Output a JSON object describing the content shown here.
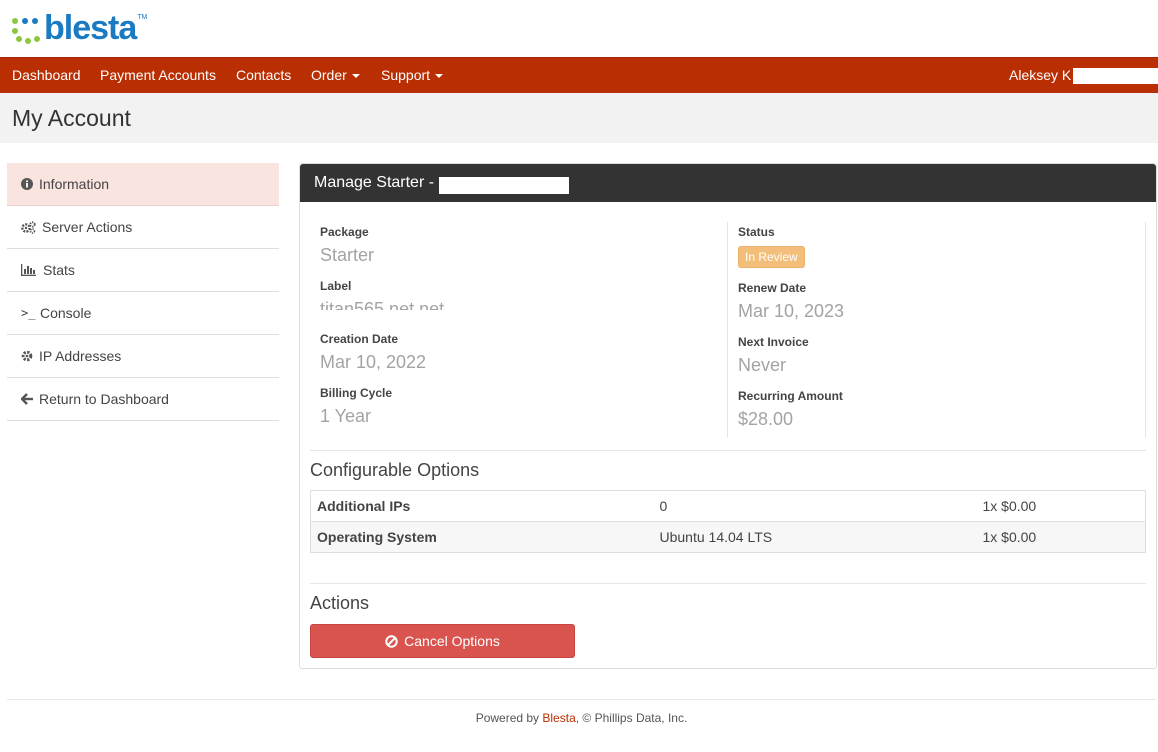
{
  "brand": {
    "name": "blesta",
    "tm": "TM",
    "accent": "#b92e02",
    "logo_color": "#1a7ac2"
  },
  "nav": {
    "items": [
      {
        "label": "Dashboard"
      },
      {
        "label": "Payment Accounts"
      },
      {
        "label": "Contacts"
      },
      {
        "label": "Order"
      },
      {
        "label": "Support"
      }
    ],
    "user_name": "Aleksey K"
  },
  "page_title": "My Account",
  "sidebar": {
    "items": [
      {
        "label": "Information",
        "icon": "info-circle-icon"
      },
      {
        "label": "Server Actions",
        "icon": "cogs-icon"
      },
      {
        "label": "Stats",
        "icon": "bar-chart-icon"
      },
      {
        "label": "Console",
        "icon": "terminal-icon"
      },
      {
        "label": "IP Addresses",
        "icon": "gear-icon"
      },
      {
        "label": "Return to Dashboard",
        "icon": "arrow-left-icon"
      }
    ]
  },
  "panel": {
    "title": "Manage Starter - ",
    "details": {
      "package_label": "Package",
      "package": "Starter",
      "label_label": "Label",
      "label": "titan565.net.net",
      "creation_label": "Creation Date",
      "creation": "Mar 10, 2022",
      "cycle_label": "Billing Cycle",
      "cycle": "1 Year",
      "status_label": "Status",
      "status": "In Review",
      "renew_label": "Renew Date",
      "renew": "Mar 10, 2023",
      "next_invoice_label": "Next Invoice",
      "next_invoice": "Never",
      "recurring_label": "Recurring Amount",
      "recurring": "$28.00"
    },
    "configurable_title": "Configurable Options",
    "options": [
      {
        "name": "Additional IPs",
        "value": "0",
        "price": "1x $0.00"
      },
      {
        "name": "Operating System",
        "value": "Ubuntu 14.04 LTS",
        "price": "1x $0.00"
      }
    ],
    "actions_title": "Actions",
    "cancel_label": "Cancel Options"
  },
  "footer": {
    "prefix": "Powered by ",
    "link": "Blesta",
    "suffix": ", © Phillips Data, Inc."
  }
}
